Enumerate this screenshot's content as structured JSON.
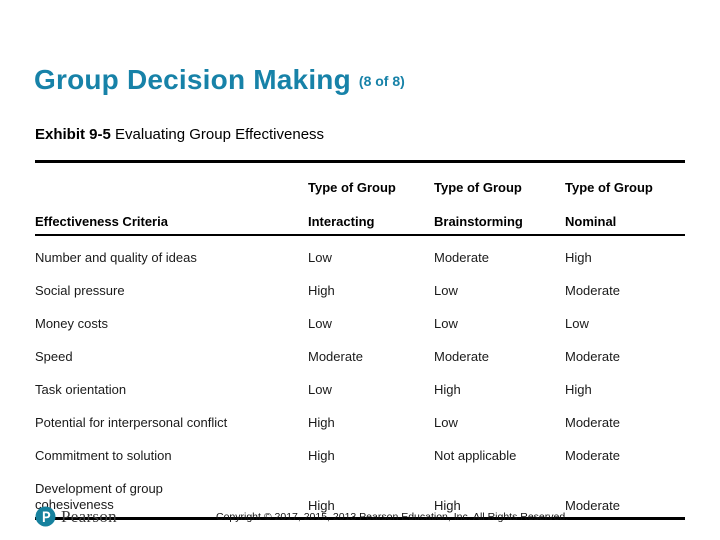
{
  "slide": {
    "title": "Group Decision Making",
    "title_counter": "(8 of 8)",
    "title_color": "#1782A8",
    "exhibit_label": "Exhibit 9-5",
    "exhibit_text": "Evaluating Group Effectiveness"
  },
  "table": {
    "group_header": [
      "Type of Group",
      "Type of Group",
      "Type of Group"
    ],
    "columns": [
      "Effectiveness Criteria",
      "Interacting",
      "Brainstorming",
      "Nominal"
    ],
    "rows": [
      {
        "criteria": "Number and quality of ideas",
        "interacting": "Low",
        "brainstorming": "Moderate",
        "nominal": "High"
      },
      {
        "criteria": "Social pressure",
        "interacting": "High",
        "brainstorming": "Low",
        "nominal": "Moderate"
      },
      {
        "criteria": "Money costs",
        "interacting": "Low",
        "brainstorming": "Low",
        "nominal": "Low"
      },
      {
        "criteria": "Speed",
        "interacting": "Moderate",
        "brainstorming": "Moderate",
        "nominal": "Moderate"
      },
      {
        "criteria": "Task orientation",
        "interacting": "Low",
        "brainstorming": "High",
        "nominal": "High"
      },
      {
        "criteria": "Potential for interpersonal conflict",
        "interacting": "High",
        "brainstorming": "Low",
        "nominal": "Moderate"
      },
      {
        "criteria": "Commitment to solution",
        "interacting": "High",
        "brainstorming": "Not applicable",
        "nominal": "Moderate"
      },
      {
        "criteria_line1": "Development of group",
        "criteria_line2": "cohesiveness",
        "interacting": "High",
        "brainstorming": "High",
        "nominal": "Moderate"
      }
    ]
  },
  "footer": {
    "logo_word": "Pearson",
    "logo_letter": "P",
    "logo_color": "#16819E",
    "copyright": "Copyright © 2017, 2015, 2013 Pearson Education, Inc. All Rights Reserved."
  }
}
